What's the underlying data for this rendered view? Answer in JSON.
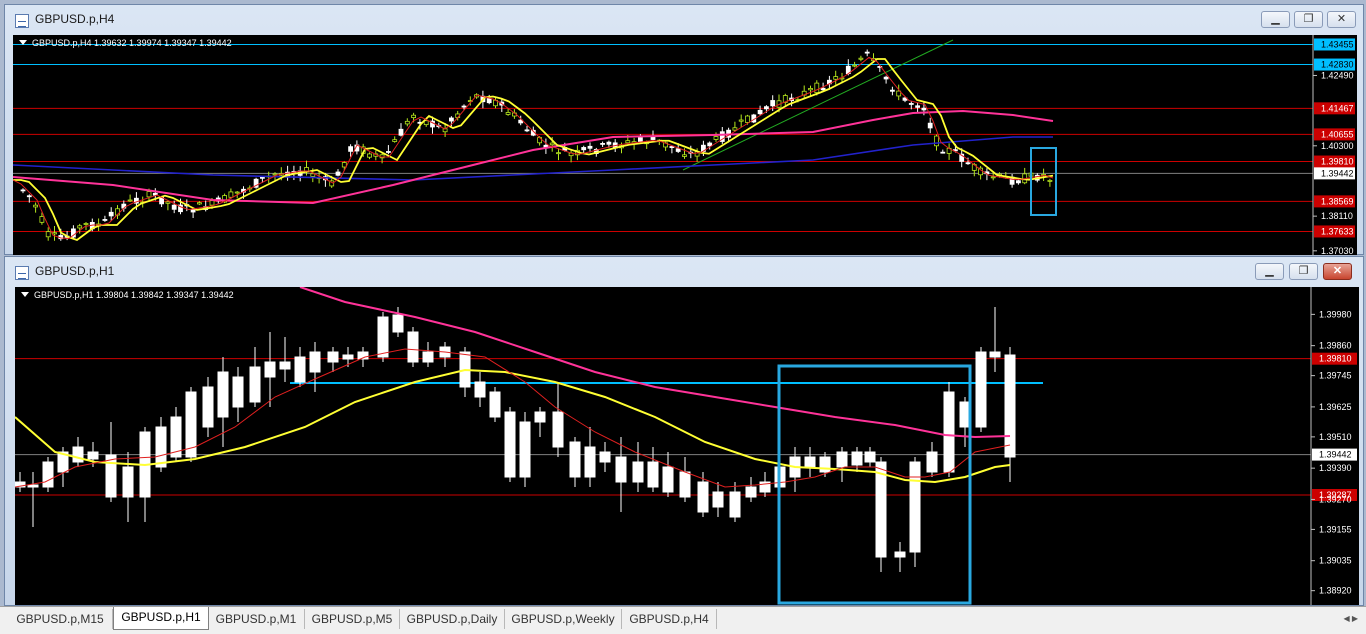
{
  "windows": {
    "h4": {
      "title": "GBPUSD.p,H4",
      "header": "GBPUSD.p,H4  1.39632 1.39974 1.39347 1.39442",
      "price_axis": [
        "1.43455",
        "1.42830",
        "1.42490",
        "1.41467",
        "1.40655",
        "1.40300",
        "1.39810",
        "1.39442",
        "1.38569",
        "1.38110",
        "1.37633",
        "1.37030"
      ],
      "buttons": {
        "minimize": "▁",
        "restore": "❐",
        "close": "✕"
      }
    },
    "h1": {
      "title": "GBPUSD.p,H1",
      "header": "GBPUSD.p,H1  1.39804 1.39842 1.39347 1.39442",
      "price_axis": [
        "1.39980",
        "1.39860",
        "1.39810",
        "1.39745",
        "1.39625",
        "1.39510",
        "1.39442",
        "1.39390",
        "1.39287",
        "1.39270",
        "1.39155",
        "1.39035",
        "1.38920"
      ],
      "buttons": {
        "minimize": "▁",
        "restore": "❐",
        "close": "✕"
      }
    }
  },
  "tabs": [
    "GBPUSD.p,M15",
    "GBPUSD.p,H1",
    "GBPUSD.p,M1",
    "GBPUSD.p,M5",
    "GBPUSD.p,Daily",
    "GBPUSD.p,Weekly",
    "GBPUSD.p,H4"
  ],
  "active_tab": "GBPUSD.p,H1",
  "tab_scroll": "◀ ▶",
  "colors": {
    "chart_bg": "#000000",
    "bull": "#b5e61d",
    "bear": "#ffffff",
    "ma_fast": "#e02020",
    "ma_mid": "#ffff33",
    "ma_slow": "#ff3399",
    "ma_long": "#2222cc",
    "hline_red": "#cc0000",
    "hline_blue": "#00bfff",
    "highlight_box": "#29a8e0"
  }
}
